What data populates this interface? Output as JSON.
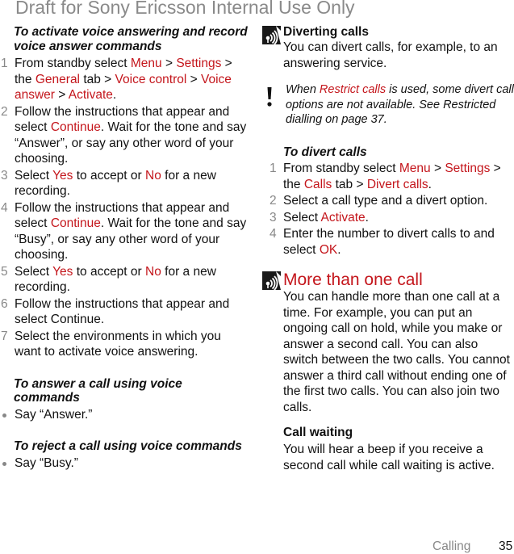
{
  "watermark": "Draft for Sony Ericsson Internal Use Only",
  "left": {
    "activate_heading": "To activate voice answering and record voice answer commands",
    "steps": [
      {
        "num": "1",
        "parts": [
          {
            "t": "From standby select "
          },
          {
            "t": "Menu",
            "red": true
          },
          {
            "t": " > "
          },
          {
            "t": "Settings",
            "red": true
          },
          {
            "t": " > the "
          },
          {
            "t": "General",
            "red": true
          },
          {
            "t": " tab > "
          },
          {
            "t": "Voice control",
            "red": true
          },
          {
            "t": " > "
          },
          {
            "t": "Voice answer",
            "red": true
          },
          {
            "t": " > "
          },
          {
            "t": "Activate",
            "red": true
          },
          {
            "t": "."
          }
        ]
      },
      {
        "num": "2",
        "parts": [
          {
            "t": "Follow the instructions that appear and select "
          },
          {
            "t": "Continue",
            "red": true
          },
          {
            "t": ". Wait for the tone and say “Answer”, or say any other word of your choosing."
          }
        ]
      },
      {
        "num": "3",
        "parts": [
          {
            "t": "Select "
          },
          {
            "t": "Yes",
            "red": true
          },
          {
            "t": " to accept or "
          },
          {
            "t": "No",
            "red": true
          },
          {
            "t": " for a new recording."
          }
        ]
      },
      {
        "num": "4",
        "parts": [
          {
            "t": "Follow the instructions that appear and select "
          },
          {
            "t": "Continue",
            "red": true
          },
          {
            "t": ". Wait for the tone and say “Busy”, or say any other word of your choosing."
          }
        ]
      },
      {
        "num": "5",
        "parts": [
          {
            "t": "Select "
          },
          {
            "t": "Yes",
            "red": true
          },
          {
            "t": " to accept or "
          },
          {
            "t": "No",
            "red": true
          },
          {
            "t": " for a new recording."
          }
        ]
      },
      {
        "num": "6",
        "parts": [
          {
            "t": "Follow the instructions that appear and select Continue."
          }
        ]
      },
      {
        "num": "7",
        "parts": [
          {
            "t": "Select the environments in which you want to activate voice answering."
          }
        ]
      }
    ],
    "answer_heading": "To answer a call using voice commands",
    "answer_bullet": "Say “Answer.”",
    "reject_heading": "To reject a call using voice commands",
    "reject_bullet": "Say “Busy.”"
  },
  "right": {
    "diverting_title": "Diverting calls",
    "diverting_body": "You can divert calls, for example, to an answering service.",
    "note_parts": [
      {
        "t": "When "
      },
      {
        "t": "Restrict calls",
        "red": true
      },
      {
        "t": " is used, some divert call options are not available. See Restricted dialling on page 37."
      }
    ],
    "divert_heading": "To divert calls",
    "divert_steps": [
      {
        "num": "1",
        "parts": [
          {
            "t": "From standby select "
          },
          {
            "t": "Menu",
            "red": true
          },
          {
            "t": " > "
          },
          {
            "t": "Settings",
            "red": true
          },
          {
            "t": " > the "
          },
          {
            "t": "Calls",
            "red": true
          },
          {
            "t": " tab > "
          },
          {
            "t": "Divert calls",
            "red": true
          },
          {
            "t": "."
          }
        ]
      },
      {
        "num": "2",
        "parts": [
          {
            "t": "Select a call type and a divert option."
          }
        ]
      },
      {
        "num": "3",
        "parts": [
          {
            "t": "Select "
          },
          {
            "t": "Activate",
            "red": true
          },
          {
            "t": "."
          }
        ]
      },
      {
        "num": "4",
        "parts": [
          {
            "t": "Enter the number to divert calls to and select "
          },
          {
            "t": "OK",
            "red": true
          },
          {
            "t": "."
          }
        ]
      }
    ],
    "more_title": "More than one call",
    "more_body": "You can handle more than one call at a time. For example, you can put an ongoing call on hold, while you make or answer a second call. You can also switch between the two calls. You cannot answer a third call without ending one of the first two calls. You can also join two calls.",
    "waiting_title": "Call waiting",
    "waiting_body": "You will hear a beep if you receive a second call while call waiting is active."
  },
  "footer": {
    "section": "Calling",
    "page": "35"
  },
  "colors": {
    "accent_red": "#c4161c",
    "muted_gray": "#888888",
    "watermark_gray": "#8a8a8a"
  }
}
